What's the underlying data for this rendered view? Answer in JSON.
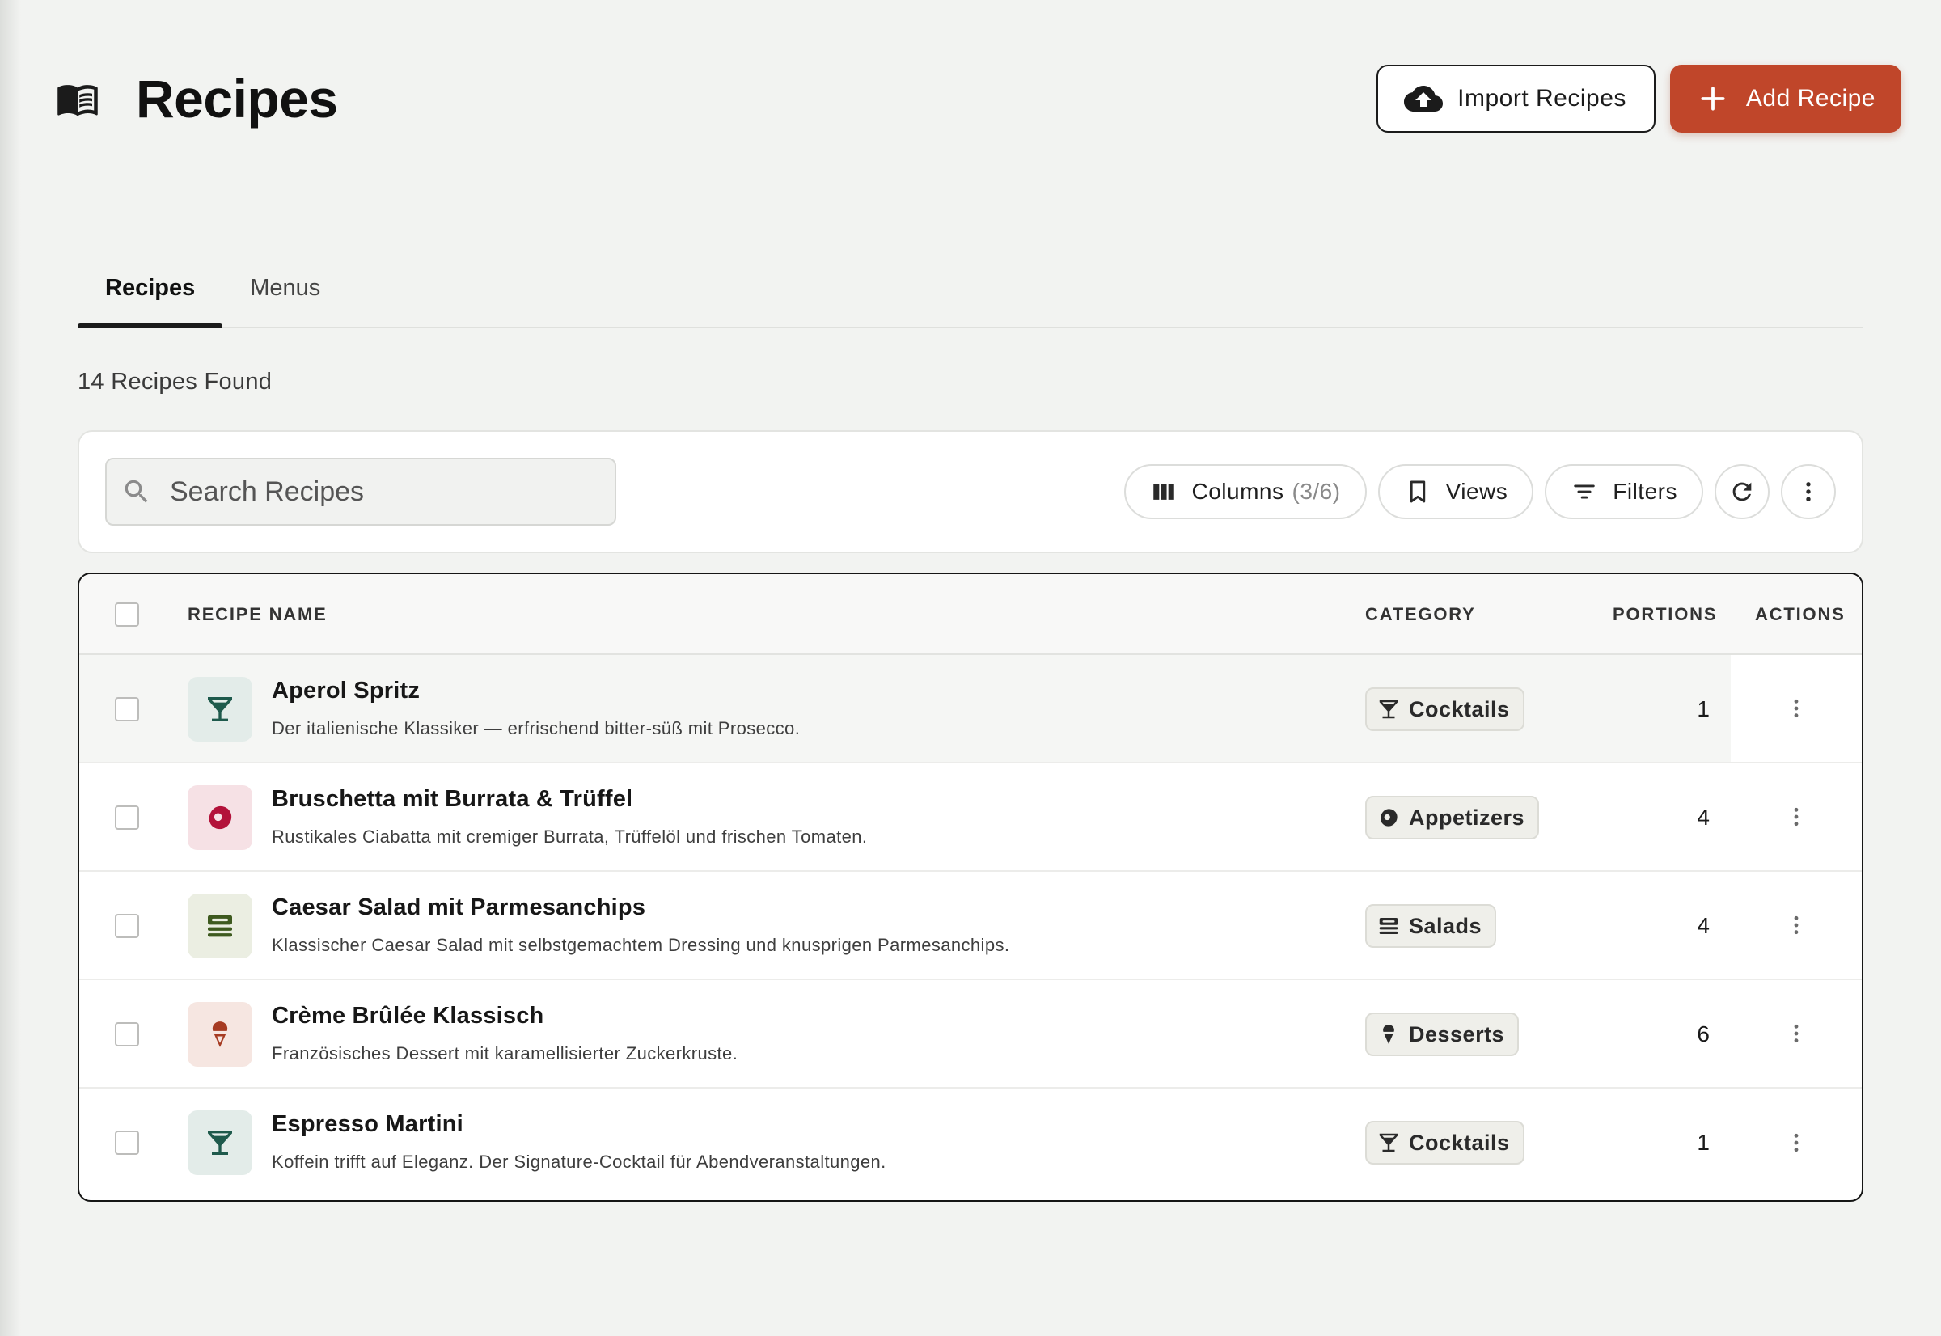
{
  "header": {
    "title": "Recipes",
    "icon": "menu-book-icon",
    "import_label": "Import Recipes",
    "add_label": "Add Recipe",
    "accent_color": "#c0462a"
  },
  "tabs": [
    {
      "label": "Recipes",
      "active": true
    },
    {
      "label": "Menus",
      "active": false
    }
  ],
  "count_text": "14 Recipes Found",
  "toolbar": {
    "search_placeholder": "Search Recipes",
    "columns_label": "Columns",
    "columns_count": "(3/6)",
    "views_label": "Views",
    "filters_label": "Filters"
  },
  "table": {
    "headers": {
      "name": "RECIPE NAME",
      "category": "CATEGORY",
      "portions": "PORTIONS",
      "actions": "ACTIONS"
    },
    "rows": [
      {
        "name": "Aperol Spritz",
        "description": "Der italienische Klassiker — erfrischend bitter-süß mit Prosecco.",
        "category": "Cocktails",
        "category_icon": "cocktail-icon",
        "portions": "1",
        "thumb_color": "#e3ece9",
        "icon_color": "#1e5a4c"
      },
      {
        "name": "Bruschetta mit Burrata & Trüffel",
        "description": "Rustikales Ciabatta mit cremiger Burrata, Trüffelöl und frischen Tomaten.",
        "category": "Appetizers",
        "category_icon": "appetizer-icon",
        "portions": "4",
        "thumb_color": "#f6e1e5",
        "icon_color": "#b3123a"
      },
      {
        "name": "Caesar Salad mit Parmesanchips",
        "description": "Klassischer Caesar Salad mit selbstgemachtem Dressing und knusprigen Parmesanchips.",
        "category": "Salads",
        "category_icon": "salad-icon",
        "portions": "4",
        "thumb_color": "#ebeee2",
        "icon_color": "#3e5a1f"
      },
      {
        "name": "Crème Brûlée Klassisch",
        "description": "Französisches Dessert mit karamellisierter Zuckerkruste.",
        "category": "Desserts",
        "category_icon": "ice-cream-icon",
        "portions": "6",
        "thumb_color": "#f6e6e1",
        "icon_color": "#a63b22"
      },
      {
        "name": "Espresso Martini",
        "description": "Koffein trifft auf Eleganz. Der Signature-Cocktail für Abendveranstaltungen.",
        "category": "Cocktails",
        "category_icon": "cocktail-icon",
        "portions": "1",
        "thumb_color": "#e3ece9",
        "icon_color": "#1e5a4c"
      }
    ]
  }
}
